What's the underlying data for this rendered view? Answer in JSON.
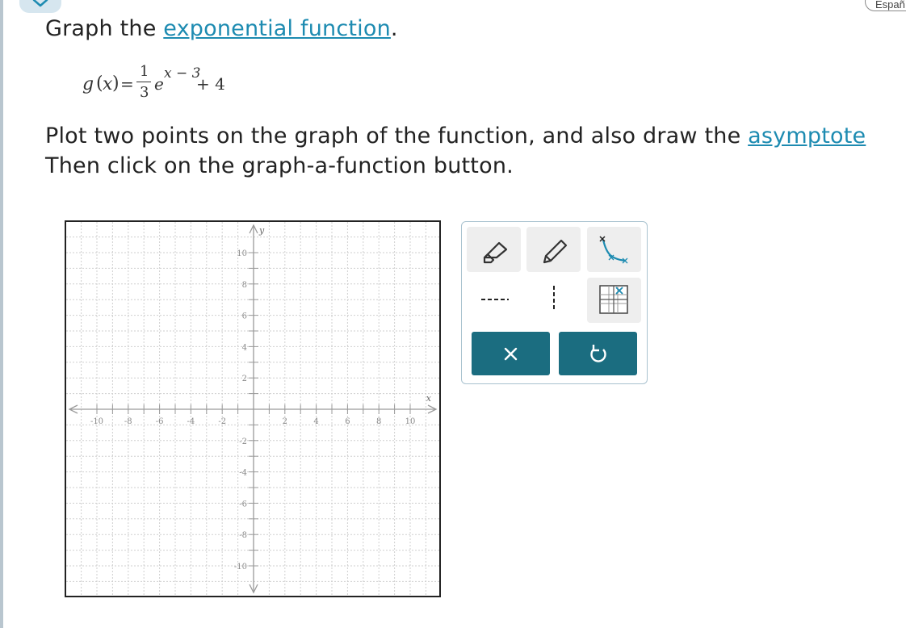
{
  "header": {
    "language_button": "Españ"
  },
  "question": {
    "line1_prefix": "Graph the ",
    "line1_link": "exponential function",
    "line1_suffix": ".",
    "formula": {
      "lhs": "g",
      "var_open": "(",
      "var": "x",
      "var_close": ")",
      "equals": "=",
      "coef_num": "1",
      "coef_den": "3",
      "base": "e",
      "exponent": "x − 3",
      "constant": "+ 4"
    },
    "line2_prefix": "Plot two points on the graph of the function, and also draw the ",
    "line2_link": "asymptote",
    "line3": "Then click on the graph-a-function button."
  },
  "graph": {
    "x_label": "x",
    "y_label": "y",
    "range": [
      -11,
      11
    ],
    "x_tick_labels": [
      "-10",
      "-8",
      "-6",
      "-4",
      "-2",
      "2",
      "4",
      "6",
      "8",
      "10"
    ],
    "y_tick_labels": [
      "10",
      "8",
      "6",
      "4",
      "2",
      "-2",
      "-4",
      "-6",
      "-8",
      "-10"
    ]
  },
  "toolbox": {
    "tools": [
      "eraser-icon",
      "pencil-icon",
      "graph-function-icon",
      "dashed-horizontal-line-icon",
      "dashed-vertical-line-icon",
      "grid-toggle-icon"
    ],
    "actions": [
      "clear-icon",
      "undo-icon"
    ],
    "accent_color": "#1b6d80",
    "tool_bg": "#eeeeee"
  },
  "colors": {
    "link": "#1d8bb1",
    "grid": "#cfcfcf",
    "axis": "#9a9a9a"
  }
}
